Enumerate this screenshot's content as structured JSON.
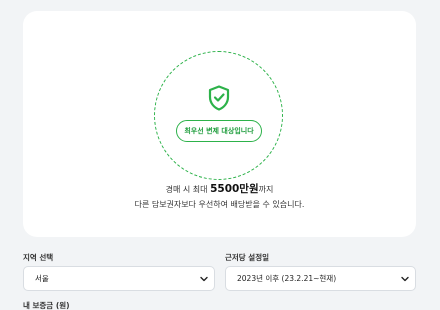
{
  "result": {
    "badge": "최우선 변제 대상입니다",
    "line1_prefix": "경매 시 최대 ",
    "line1_amount": "5500만원",
    "line1_suffix": "까지",
    "line2": "다른 담보권자보다 우선하여 배당받을 수 있습니다."
  },
  "form": {
    "region_label": "지역 선택",
    "region_value": "서울",
    "date_label": "근저당 설정일",
    "date_value": "2023년 이후 (23.2.21~현재)",
    "deposit_label": "내 보증금 (원)"
  },
  "icons": {
    "shield": "shield-check-icon",
    "chevron": "chevron-down-icon"
  },
  "colors": {
    "accent_green": "#2db24a",
    "background": "#f2f4f6"
  }
}
